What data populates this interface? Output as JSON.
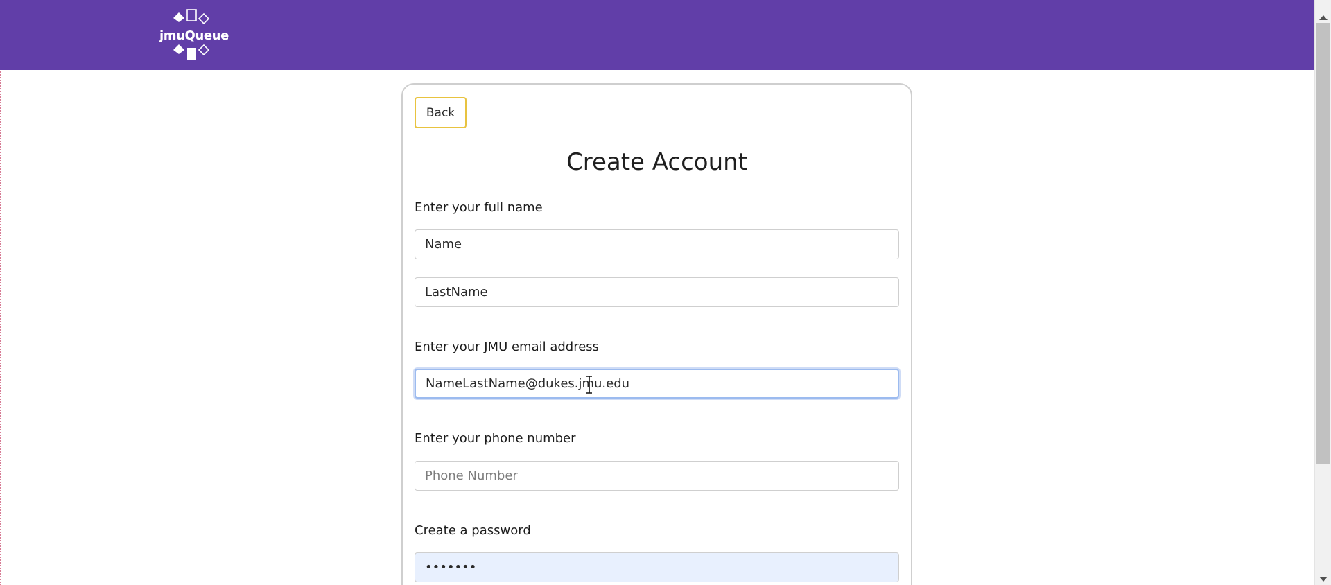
{
  "header": {
    "logo_text": "jmuQueue",
    "background_color": "#613ea8"
  },
  "form": {
    "back_label": "Back",
    "title": "Create Account",
    "full_name_label": "Enter your full name",
    "first_name_value": "Name",
    "last_name_value": "LastName",
    "email_label": "Enter your JMU email address",
    "email_value": "NameLastName@dukes.jmu.edu",
    "phone_label": "Enter your phone number",
    "phone_placeholder": "Phone Number",
    "password_label": "Create a password",
    "password_value": "•••••••"
  },
  "colors": {
    "accent_purple": "#613ea8",
    "back_button_border": "#e8c340",
    "focus_ring": "#9cbbef",
    "autofill_bg": "#e8f0fe"
  },
  "icons": {
    "logo": "jmuqueue-logo-icon",
    "text_cursor": "i-beam-cursor-icon"
  }
}
